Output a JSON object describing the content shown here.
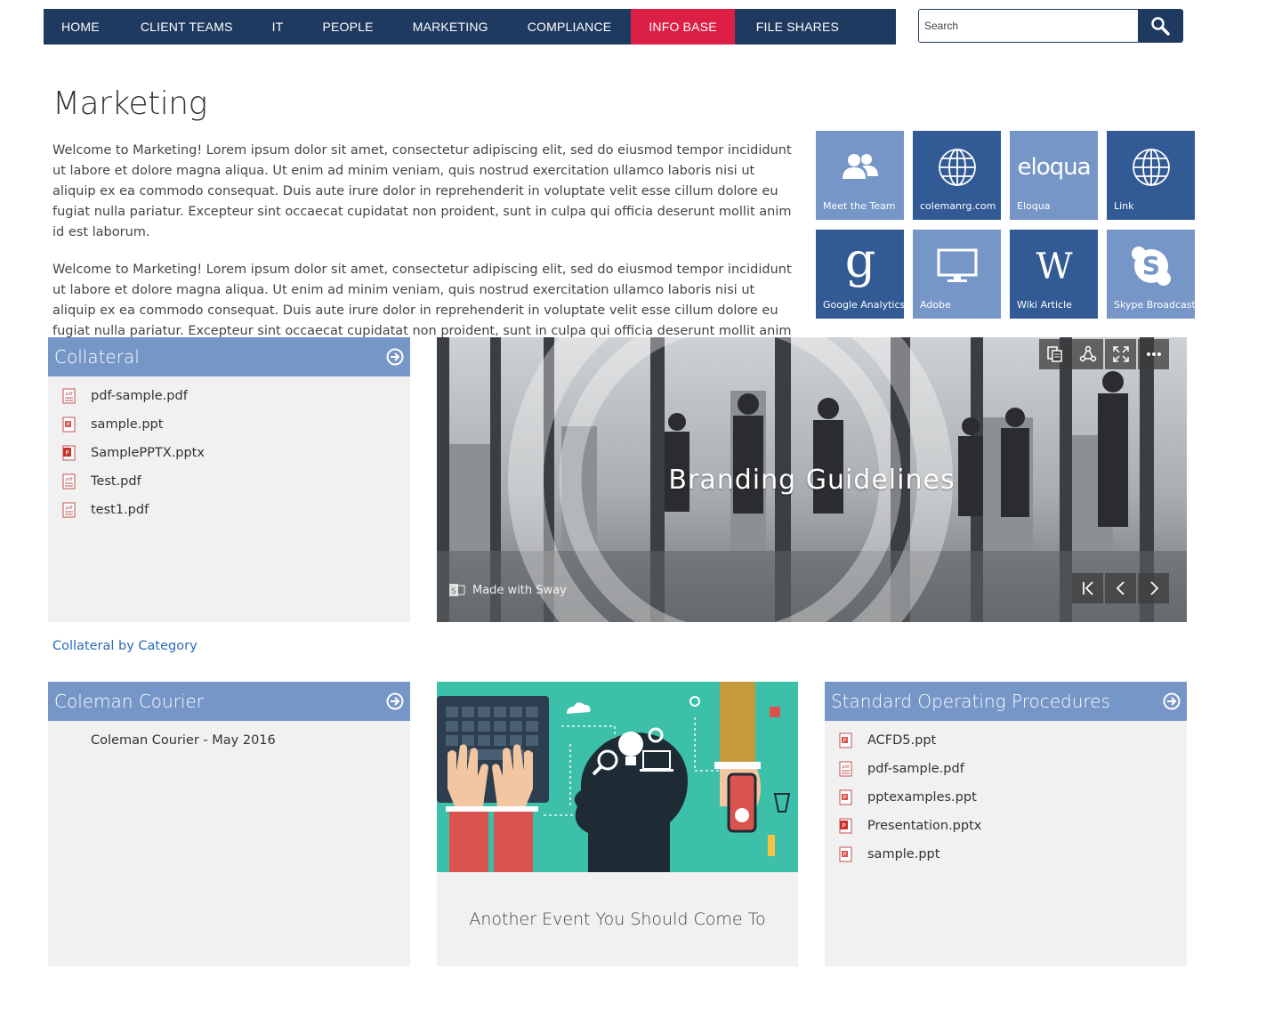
{
  "nav": {
    "items": [
      "HOME",
      "CLIENT TEAMS",
      "IT",
      "PEOPLE",
      "MARKETING",
      "COMPLIANCE",
      "INFO BASE",
      "FILE SHARES"
    ],
    "active_color": "#dc1f45",
    "bar_color": "#1f3a60"
  },
  "search": {
    "placeholder": "Search",
    "icon": "search-icon"
  },
  "page": {
    "title": "Marketing",
    "paragraphs": [
      "Welcome to Marketing! Lorem ipsum dolor sit amet, consectetur adipiscing elit, sed do eiusmod tempor incididunt ut labore et dolore magna aliqua. Ut enim ad minim veniam, quis nostrud exercitation ullamco laboris nisi ut aliquip ex ea commodo consequat. Duis aute irure dolor in reprehenderit in voluptate velit esse cillum dolore eu fugiat nulla pariatur. Excepteur sint occaecat cupidatat non proident, sunt in culpa qui officia deserunt mollit anim id est laborum.",
      "Welcome to Marketing! Lorem ipsum dolor sit amet, consectetur adipiscing elit, sed do eiusmod tempor incididunt ut labore et dolore magna aliqua. Ut enim ad minim veniam, quis nostrud exercitation ullamco laboris nisi ut aliquip ex ea commodo consequat. Duis aute irure dolor in reprehenderit in voluptate velit esse cillum dolore eu fugiat nulla pariatur. Excepteur sint occaecat cupidatat non proident, sunt in culpa qui officia deserunt mollit anim id est laborum."
    ]
  },
  "tiles": [
    {
      "label": "Meet the Team",
      "icon": "people-icon"
    },
    {
      "label": "colemanrg.com",
      "icon": "globe-icon"
    },
    {
      "label": "Eloqua",
      "icon": "eloqua-logo",
      "logo_text": "eloqua"
    },
    {
      "label": "Link",
      "icon": "globe-icon"
    },
    {
      "label": "Google Analytics",
      "icon": "google-icon"
    },
    {
      "label": "Adobe",
      "icon": "monitor-icon"
    },
    {
      "label": "Wiki Article",
      "icon": "wikipedia-icon"
    },
    {
      "label": "Skype Broadcast",
      "icon": "skype-icon"
    }
  ],
  "collateral": {
    "title": "Collateral",
    "files": [
      "pdf-sample.pdf",
      "sample.ppt",
      "SamplePPTX.pptx",
      "Test.pdf",
      "test1.pdf"
    ],
    "link": "Collateral by Category"
  },
  "sway": {
    "title": "Branding Guidelines",
    "made_with": "Made with Sway"
  },
  "courier": {
    "title": "Coleman Courier",
    "items": [
      "Coleman Courier - May 2016"
    ]
  },
  "event": {
    "title": "Another Event You Should Come To"
  },
  "sop": {
    "title": "Standard Operating Procedures",
    "files": [
      "ACFD5.ppt",
      "pdf-sample.pdf",
      "pptexamples.ppt",
      "Presentation.pptx",
      "sample.ppt"
    ]
  }
}
